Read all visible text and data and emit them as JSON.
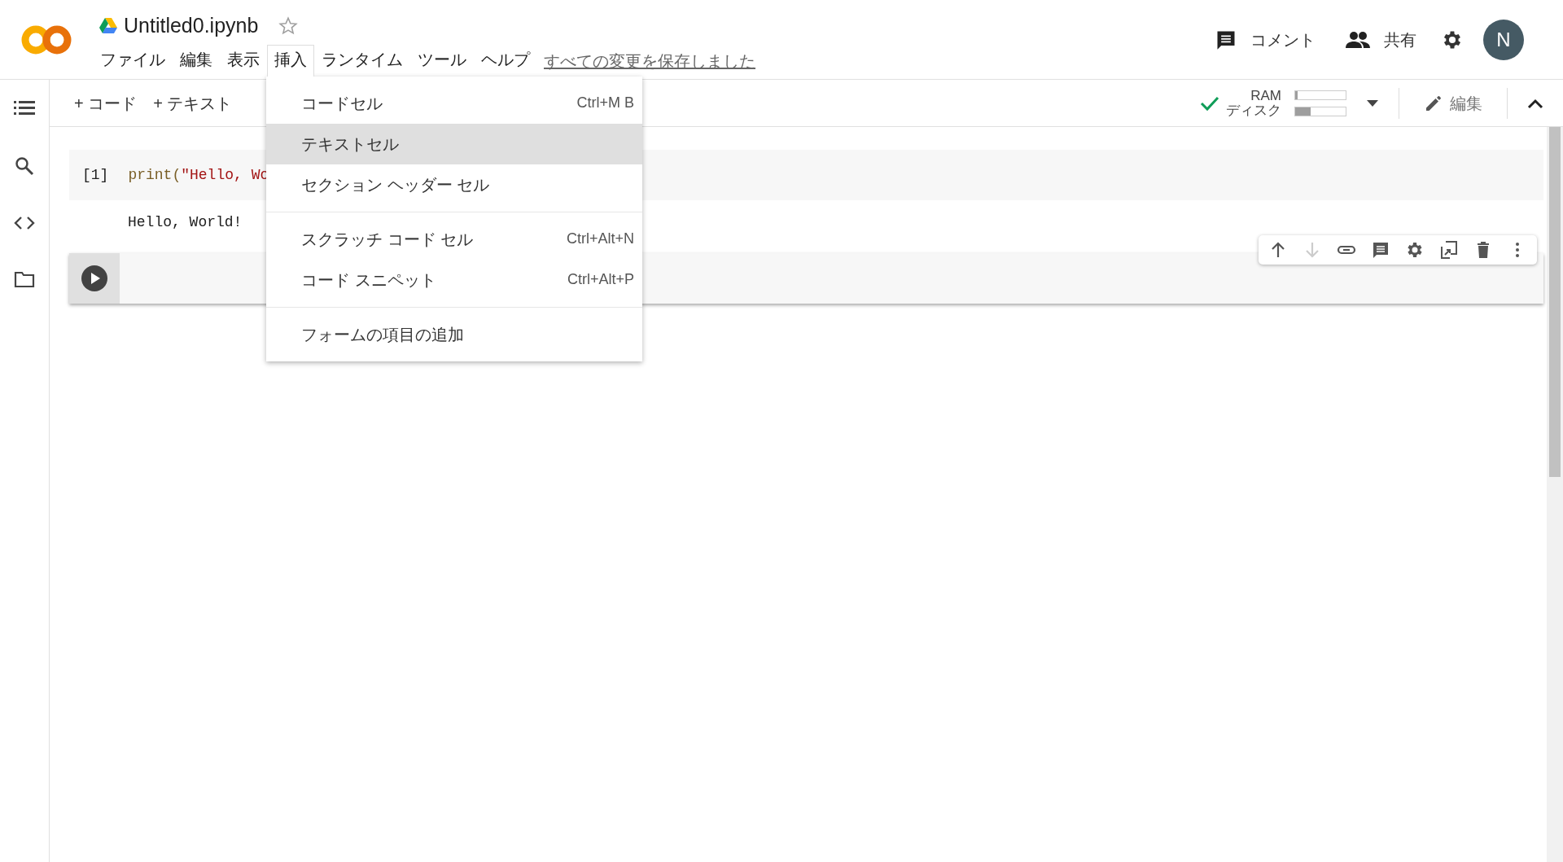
{
  "header": {
    "title": "Untitled0.ipynb",
    "starred": false,
    "menus": [
      {
        "label": "ファイル",
        "selected": false
      },
      {
        "label": "編集",
        "selected": false
      },
      {
        "label": "表示",
        "selected": false
      },
      {
        "label": "挿入",
        "selected": true
      },
      {
        "label": "ランタイム",
        "selected": false
      },
      {
        "label": "ツール",
        "selected": false
      },
      {
        "label": "ヘルプ",
        "selected": false
      }
    ],
    "save_status": "すべての変更を保存しました",
    "comment_button": "コメント",
    "share_button": "共有",
    "avatar": "N"
  },
  "insert_menu": {
    "groups": [
      [
        {
          "label": "コードセル",
          "shortcut": "Ctrl+M B",
          "selected": false
        },
        {
          "label": "テキストセル",
          "selected": true
        },
        {
          "label": "セクション ヘッダー セル",
          "selected": false
        }
      ],
      [
        {
          "label": "スクラッチ コード セル",
          "shortcut": "Ctrl+Alt+N",
          "selected": false
        },
        {
          "label": "コード スニペット",
          "shortcut": "Ctrl+Alt+P",
          "selected": false
        }
      ],
      [
        {
          "label": "フォームの項目の追加",
          "selected": false
        }
      ]
    ]
  },
  "toolbar": {
    "add_code": "+ コード",
    "add_text": "+ テキスト",
    "ram_label": "RAM",
    "ram": {
      "level": 0.05
    },
    "disk_label": "ディスク",
    "disk": {
      "level": 0.3
    },
    "edit_button": "編集"
  },
  "cells": [
    {
      "kind": "code",
      "count": "[1]",
      "code": "print(\"Hello, Wo",
      "output": "Hello, World!"
    },
    {
      "kind": "empty"
    }
  ],
  "cell_toolbar": [
    {
      "kind": "up",
      "disabled": false
    },
    {
      "kind": "down",
      "disabled": true
    },
    {
      "kind": "link",
      "disabled": false
    },
    {
      "kind": "comment",
      "disabled": false
    },
    {
      "kind": "settings",
      "disabled": false
    },
    {
      "kind": "mirror",
      "disabled": false
    },
    {
      "kind": "delete",
      "disabled": false
    },
    {
      "kind": "more",
      "disabled": false
    }
  ]
}
